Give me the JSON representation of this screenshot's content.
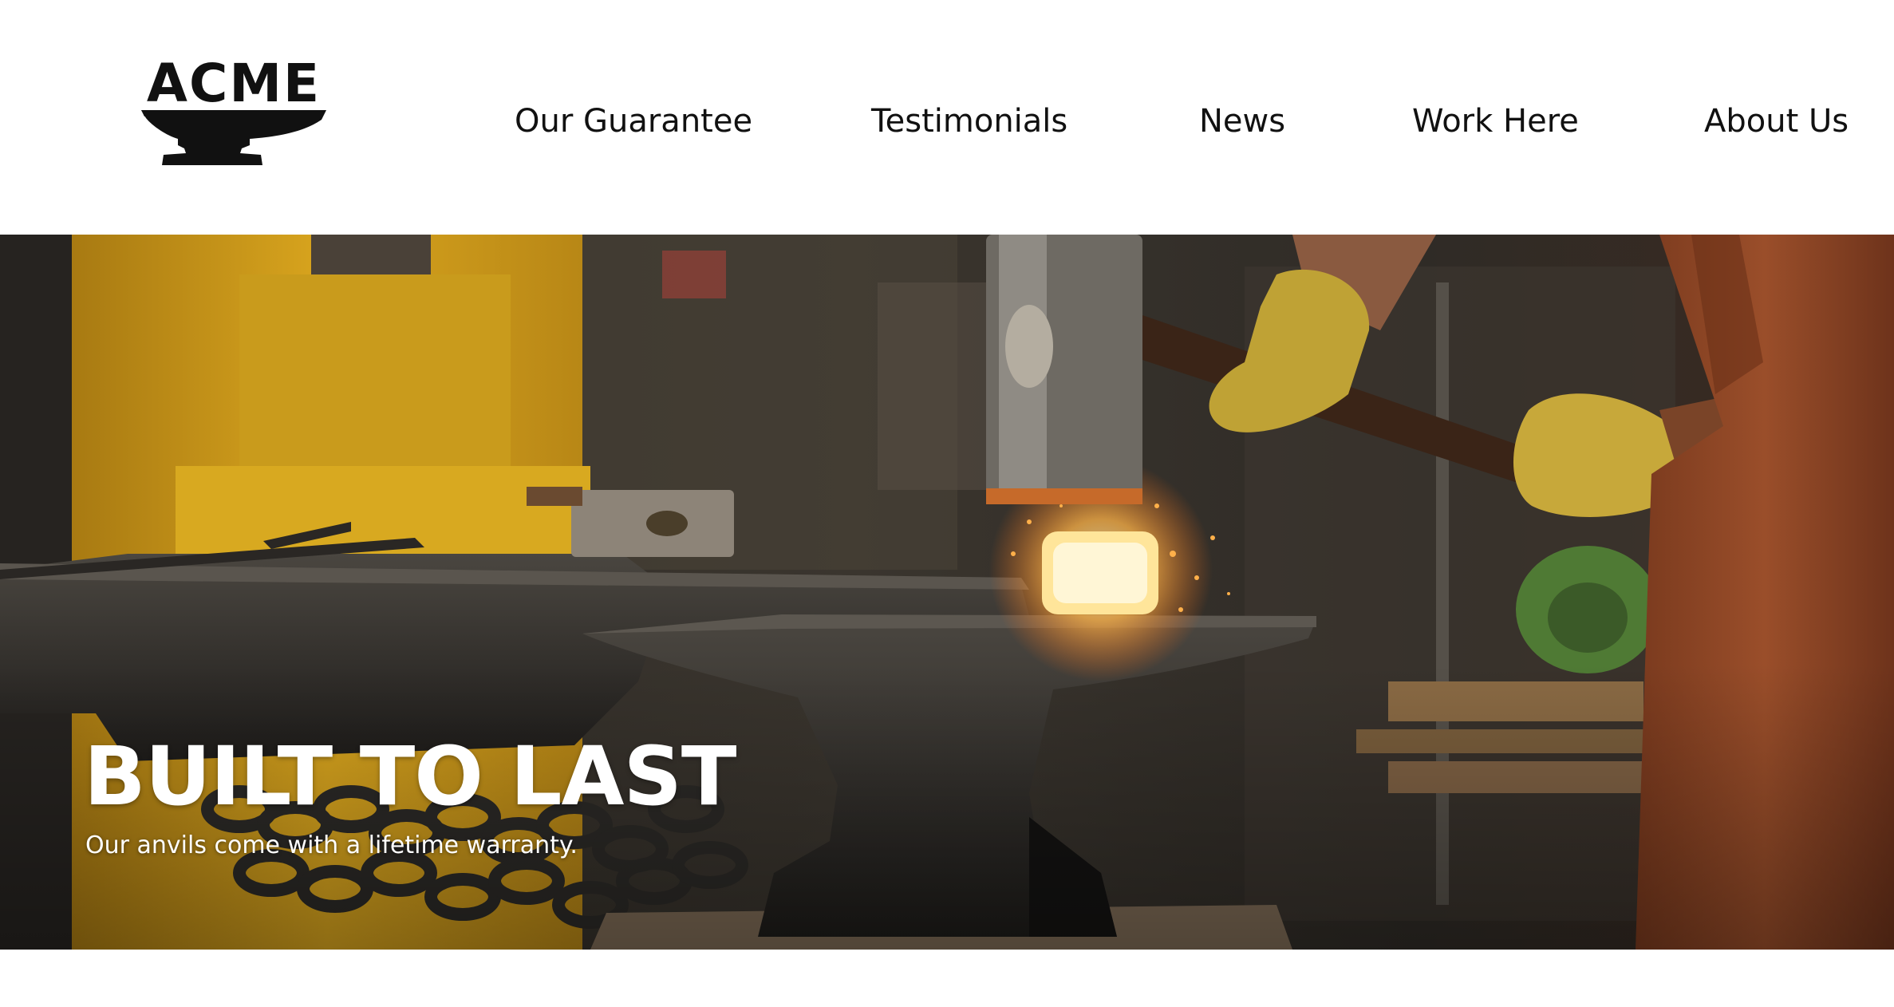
{
  "header": {
    "logo_text": "ACME",
    "logo_icon": "anvil-icon",
    "nav": [
      {
        "label": "Our Guarantee"
      },
      {
        "label": "Testimonials"
      },
      {
        "label": "News"
      },
      {
        "label": "Work Here"
      },
      {
        "label": "About Us"
      }
    ]
  },
  "hero": {
    "image": "blacksmith-forging-on-anvil",
    "title": "BUILT TO LAST",
    "subtitle": "Our anvils come with a lifetime warranty."
  },
  "colors": {
    "text": "#111111",
    "hero_text": "#ffffff",
    "machine_yellow": "#d4a21c",
    "glow_orange": "#ff8a2a",
    "apron_brown": "#8a4524"
  }
}
